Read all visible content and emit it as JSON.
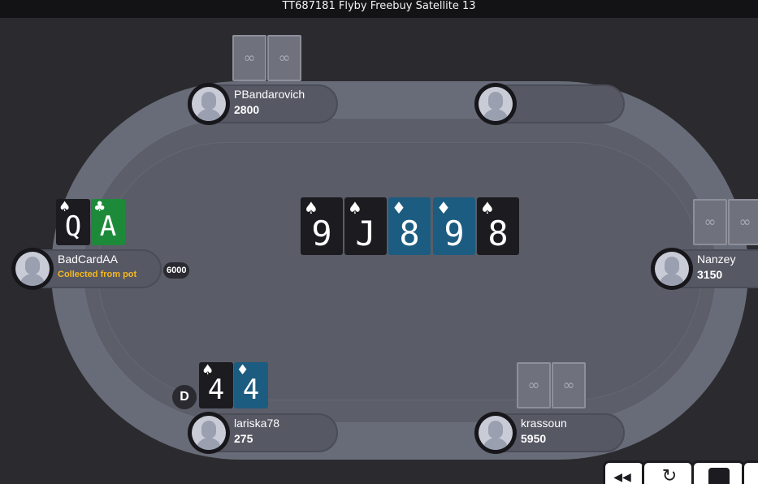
{
  "window": {
    "title": "TT687181 Flyby Freebuy Satellite 13"
  },
  "board": [
    {
      "rank": "9",
      "suit": "spade",
      "suit_glyph": "♠"
    },
    {
      "rank": "J",
      "suit": "spade",
      "suit_glyph": "♠"
    },
    {
      "rank": "8",
      "suit": "diamond",
      "suit_glyph": "♦"
    },
    {
      "rank": "9",
      "suit": "diamond",
      "suit_glyph": "♦"
    },
    {
      "rank": "8",
      "suit": "spade",
      "suit_glyph": "♠"
    }
  ],
  "players": {
    "top_left": {
      "name": "PBandarovich",
      "stack": "2800"
    },
    "top_right": {
      "name": "",
      "stack": ""
    },
    "left": {
      "name": "BadCardAA",
      "status": "Collected from pot",
      "bet": "6000",
      "cards": [
        {
          "rank": "Q",
          "suit": "spade",
          "suit_glyph": "♠"
        },
        {
          "rank": "A",
          "suit": "club",
          "suit_glyph": "♣"
        }
      ]
    },
    "right": {
      "name": "Nanzey",
      "stack": "3150"
    },
    "bottom_left": {
      "name": "lariska78",
      "stack": "275",
      "cards": [
        {
          "rank": "4",
          "suit": "spade",
          "suit_glyph": "♠"
        },
        {
          "rank": "4",
          "suit": "diamond",
          "suit_glyph": "♦"
        }
      ]
    },
    "bottom_right": {
      "name": "krassoun",
      "stack": "5950"
    }
  },
  "dealer_button": "D",
  "colors": {
    "background": "#2b2b2f",
    "table": "#686b78",
    "status": "#f5b81c",
    "spade": "#1c1c20",
    "diamond": "#1c5c80",
    "club": "#1d8a3a"
  },
  "icons": {
    "card_back": "card-back-logo-icon",
    "rewind": "rewind-icon",
    "replay": "replay-icon",
    "stop": "stop-icon"
  }
}
